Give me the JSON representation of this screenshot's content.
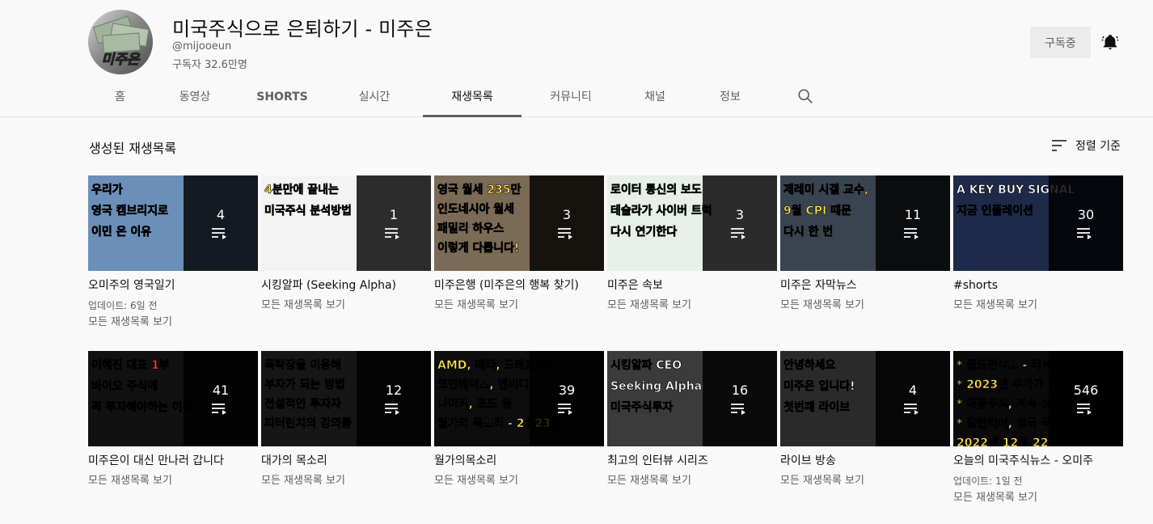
{
  "channel": {
    "name": "미국주식으로 은퇴하기 - 미주은",
    "handle": "@mijooeun",
    "subscribers": "구독자 32.6만명",
    "avatar_text": "미주은",
    "subscribe_label": "구독중"
  },
  "tabs": [
    {
      "label": "홈"
    },
    {
      "label": "동영상"
    },
    {
      "label": "SHORTS"
    },
    {
      "label": "실시간"
    },
    {
      "label": "재생목록"
    },
    {
      "label": "커뮤니티"
    },
    {
      "label": "채널"
    },
    {
      "label": "정보"
    }
  ],
  "active_tab": "재생목록",
  "section": {
    "title": "생성된 재생목록",
    "sort_label": "정렬 기준"
  },
  "playlists": [
    {
      "title": "오미주의 영국일기",
      "count": "4",
      "updated": "업데이트: 6일 전",
      "link": "모든 재생목록 보기",
      "thumb_text": [
        "우리가",
        "영국 캠브리지로",
        "이민 온 이유"
      ],
      "thumb_bg": "#6b8fb8",
      "thumb_color": "#ffe14a"
    },
    {
      "title": "시킹알파 (Seeking Alpha)",
      "count": "1",
      "updated": "",
      "link": "모든 재생목록 보기",
      "thumb_text": [
        "4분만에 끝내는",
        "미국주식 분석방법"
      ],
      "thumb_bg": "#f3f3f3",
      "thumb_color": "#ffe14a"
    },
    {
      "title": "미주은행 (미주은의 행복 찾기)",
      "count": "3",
      "updated": "",
      "link": "모든 재생목록 보기",
      "thumb_text": [
        "영국 월세 235만",
        "인도네시아 월세",
        "패밀리 하우스",
        "이렇게 다릅니다!"
      ],
      "thumb_bg": "#7b6a55",
      "thumb_color": "#ffe14a"
    },
    {
      "title": "미주은 속보",
      "count": "3",
      "updated": "",
      "link": "모든 재생목록 보기",
      "thumb_text": [
        "로이터 통신의 보도",
        "테슬라가 사이버 트럭",
        "다시 연기한다"
      ],
      "thumb_bg": "#e8eee8",
      "thumb_color": "#ffffff"
    },
    {
      "title": "미주은 자막뉴스",
      "count": "11",
      "updated": "",
      "link": "모든 재생목록 보기",
      "thumb_text": [
        "제레미 시겔 교수,",
        "9월 CPI 때문",
        "다시 한 번"
      ],
      "thumb_bg": "#3a4350",
      "thumb_color": "#ffe14a"
    },
    {
      "title": "#shorts",
      "count": "30",
      "updated": "",
      "link": "모든 재생목록 보기",
      "thumb_text": [
        "A KEY BUY SIGNAL",
        "지금 인플레이션"
      ],
      "thumb_bg": "#1d2a4a",
      "thumb_color": "#ffffff"
    },
    {
      "title": "미주은이 대신 만나러 갑니다",
      "count": "41",
      "updated": "",
      "link": "모든 재생목록 보기",
      "thumb_text": [
        "이혜진 대표 1부",
        "바이오 주식에",
        "꼭 투자해야하는 이유"
      ],
      "thumb_bg": "#111111",
      "thumb_color": "#ff3b3b"
    },
    {
      "title": "대가의 목소리",
      "count": "12",
      "updated": "",
      "link": "모든 재생목록 보기",
      "thumb_text": [
        "폭락장을 이용해",
        "부자가 되는 방법",
        "전설적인 투자자",
        "피터린치의 강의를"
      ],
      "thumb_bg": "#161616",
      "thumb_color": "#ffe14a"
    },
    {
      "title": "월가의목소리",
      "count": "39",
      "updated": "",
      "link": "모든 재생목록 보기",
      "thumb_text": [
        "AMD, 메타, 드래프트킹",
        "코인베이스, 엔비디아",
        "나이키, 포드 등",
        "월가의 목소리 - 2월23일"
      ],
      "thumb_bg": "#0d0d0d",
      "thumb_color": "#ffe14a"
    },
    {
      "title": "최고의 인터뷰 시리즈",
      "count": "16",
      "updated": "",
      "link": "모든 재생목록 보기",
      "thumb_text": [
        "시킹알파 CEO",
        "Seeking Alpha",
        "미국주식투자"
      ],
      "thumb_bg": "#3b3b3b",
      "thumb_color": "#ffffff"
    },
    {
      "title": "라이브 방송",
      "count": "4",
      "updated": "",
      "link": "모든 재생목록 보기",
      "thumb_text": [
        "안녕하세요",
        "미주은 입니다!",
        "첫번째 라이브"
      ],
      "thumb_bg": "#2a2a2a",
      "thumb_color": "#ffffff"
    },
    {
      "title": "오늘의 미국주식뉴스 - 오미주",
      "count": "546",
      "updated": "업데이트: 1일 전",
      "link": "모든 재생목록 보기",
      "thumb_text": [
        "* 골드만삭스 - 리세션",
        "* 2023년 주가가 가장",
        "* 애플주식, 계속 상승",
        "* 팔란티어, 영국 국방부",
        "2022년 12월 22일"
      ],
      "thumb_bg": "#0a0a0a",
      "thumb_color": "#ffe14a"
    }
  ],
  "colors": {
    "background": "#f9f9f9",
    "text_primary": "#0f0f0f",
    "text_secondary": "#606060",
    "overlay": "#000000"
  }
}
